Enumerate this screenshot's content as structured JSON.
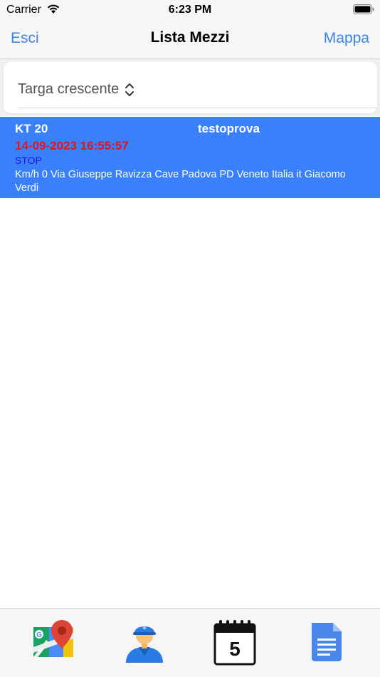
{
  "status_bar": {
    "carrier": "Carrier",
    "time": "6:23 PM"
  },
  "nav": {
    "left_button": "Esci",
    "title": "Lista Mezzi",
    "right_button": "Mappa",
    "accent_color": "#3a86e8"
  },
  "sort": {
    "selected": "Targa crescente"
  },
  "vehicles": [
    {
      "plate": "KT 20",
      "name": "testoprova",
      "timestamp": "14-09-2023 16:55:57",
      "status": "STOP",
      "address": "Km/h 0 Via Giuseppe Ravizza Cave Padova PD Veneto Italia it Giacomo Verdi",
      "row_color": "#3b80fb",
      "timestamp_color": "#e3141c",
      "status_color": "#1a14d8"
    }
  ],
  "tabs": [
    {
      "icon": "map-pin-icon"
    },
    {
      "icon": "driver-icon"
    },
    {
      "icon": "calendar-icon",
      "day": "5"
    },
    {
      "icon": "document-icon"
    }
  ]
}
